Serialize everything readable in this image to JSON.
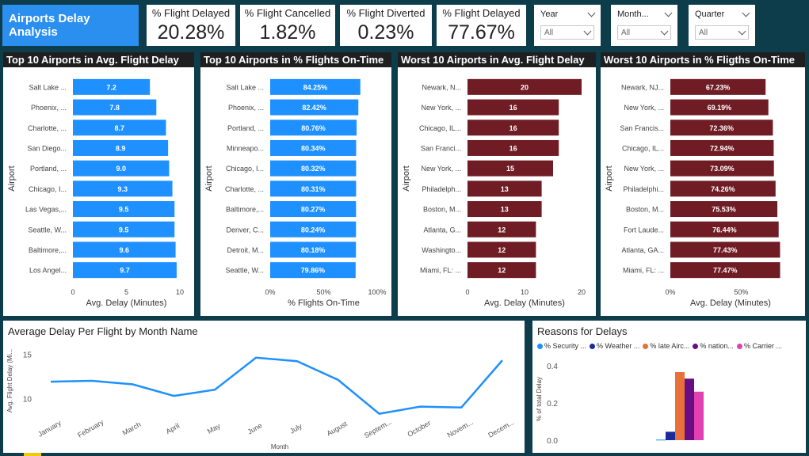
{
  "header": {
    "title": "Airports Delay Analysis"
  },
  "kpis": [
    {
      "label": "% Flight Delayed",
      "value": "20.28%"
    },
    {
      "label": "% Flight Cancelled",
      "value": "1.82%"
    },
    {
      "label": "% Flight Diverted",
      "value": "0.23%"
    },
    {
      "label": "% Flight Delayed",
      "value": "77.67%"
    }
  ],
  "slicers": [
    {
      "label": "Year",
      "value": "All"
    },
    {
      "label": "Month...",
      "value": "All"
    },
    {
      "label": "Quarter",
      "value": "All"
    }
  ],
  "colors": {
    "blue": "#1e90ff",
    "maroon": "#6f1c24",
    "header_bg": "#1f1f1f",
    "canvas": "#0d3d4a"
  },
  "chart_data": [
    {
      "type": "bar",
      "title": "Top 10 Airports in Avg. Flight Delay",
      "ylabel": "Airport",
      "xlabel": "Avg. Delay (Minutes)",
      "xticks": [
        "0",
        "5",
        "10"
      ],
      "xlim": [
        0,
        10
      ],
      "color": "#1e90ff",
      "categories": [
        "Salt Lake ...",
        "Phoenix, ...",
        "Charlotte, ...",
        "San Diego...",
        "Portland, ...",
        "Chicago, I...",
        "Las Vegas,...",
        "Seattle, W...",
        "Baltimore,...",
        "Los Angel..."
      ],
      "values": [
        7.2,
        7.8,
        8.7,
        8.9,
        9.0,
        9.3,
        9.5,
        9.5,
        9.6,
        9.7
      ],
      "data_labels": [
        "7.2",
        "7.8",
        "8.7",
        "8.9",
        "9.0",
        "9.3",
        "9.5",
        "9.5",
        "9.6",
        "9.7"
      ]
    },
    {
      "type": "bar",
      "title": "Top 10 Airports in % Flights On-Time",
      "ylabel": "Airport",
      "xlabel": "% Flights On-Time",
      "xticks": [
        "0%",
        "50%",
        "100%"
      ],
      "xlim": [
        0,
        100
      ],
      "color": "#1e90ff",
      "categories": [
        "Salt Lake ...",
        "Phoenix, ...",
        "Portland, ...",
        "Minneapo...",
        "Chicago, I...",
        "Charlotte, ...",
        "Baltimore,...",
        "Denver, C...",
        "Detroit, M...",
        "Seattle, W..."
      ],
      "values": [
        84.25,
        82.42,
        80.76,
        80.34,
        80.32,
        80.31,
        80.27,
        80.24,
        80.18,
        79.86
      ],
      "data_labels": [
        "84.25%",
        "82.42%",
        "80.76%",
        "80.34%",
        "80.32%",
        "80.31%",
        "80.27%",
        "80.24%",
        "80.18%",
        "79.86%"
      ]
    },
    {
      "type": "bar",
      "title": "Worst 10 Airports in Avg. Flight Delay",
      "ylabel": "Airport",
      "xlabel": "Avg. Delay (Minutes)",
      "xticks": [
        "0",
        "10",
        "20"
      ],
      "xlim": [
        0,
        20
      ],
      "color": "#6f1c24",
      "categories": [
        "Newark, N...",
        "New York, ...",
        "Chicago, IL...",
        "San Franci...",
        "New York, ...",
        "Philadelph...",
        "Boston, M...",
        "Atlanta, G...",
        "Washingto...",
        "Miami, FL: ..."
      ],
      "values": [
        20,
        16,
        16,
        16,
        15,
        13,
        13,
        12,
        12,
        12
      ],
      "data_labels": [
        "20",
        "16",
        "16",
        "16",
        "15",
        "13",
        "13",
        "12",
        "12",
        "12"
      ]
    },
    {
      "type": "bar",
      "title": "Worst 10 Airports in % Fligths On-Time",
      "ylabel": "Airport",
      "xlabel": "Avg. Delay (Minutes)",
      "xticks": [
        "0%",
        "50%"
      ],
      "xlim": [
        0,
        85
      ],
      "color": "#6f1c24",
      "categories": [
        "Newark, NJ...",
        "New York, ...",
        "San Francis...",
        "Chicago, IL...",
        "New York, ...",
        "Philadelphi...",
        "Boston, M...",
        "Fort Laude...",
        "Atlanta, GA...",
        "Miami, FL: ..."
      ],
      "values": [
        67.23,
        69.19,
        72.36,
        72.94,
        73.09,
        74.26,
        75.53,
        76.44,
        77.43,
        77.47
      ],
      "data_labels": [
        "67.23%",
        "69.19%",
        "72.36%",
        "72.94%",
        "73.09%",
        "74.26%",
        "75.53%",
        "76.44%",
        "77.43%",
        "77.47%"
      ]
    },
    {
      "type": "line",
      "title": "Average Delay Per Flight by Month Name",
      "xlabel": "Month",
      "ylabel": "Avg. Flight Delay (Mi...",
      "ylim": [
        8,
        16
      ],
      "yticks": [
        10,
        15
      ],
      "color": "#1e90ff",
      "categories": [
        "January",
        "February",
        "March",
        "April",
        "May",
        "June",
        "July",
        "August",
        "Septem...",
        "October",
        "Novem...",
        "Decem..."
      ],
      "values": [
        11.9,
        12.0,
        11.6,
        10.3,
        11.0,
        14.6,
        14.2,
        12.1,
        8.3,
        9.1,
        9.0,
        14.3
      ]
    },
    {
      "type": "bar",
      "title": "Reasons for Delays",
      "ylabel": "% of total Delay",
      "ylim": [
        0,
        0.45
      ],
      "yticks": [
        "0.0",
        "0.2",
        "0.4"
      ],
      "series": [
        {
          "name": "% Security ...",
          "value": 0.003,
          "color": "#1e90ff"
        },
        {
          "name": "% Weather ...",
          "value": 0.045,
          "color": "#1a2a9a"
        },
        {
          "name": "% late Airc...",
          "value": 0.365,
          "color": "#e8703a"
        },
        {
          "name": "% nation...",
          "value": 0.33,
          "color": "#6a0d83"
        },
        {
          "name": "% Carrier ...",
          "value": 0.26,
          "color": "#e040b0"
        }
      ]
    }
  ]
}
